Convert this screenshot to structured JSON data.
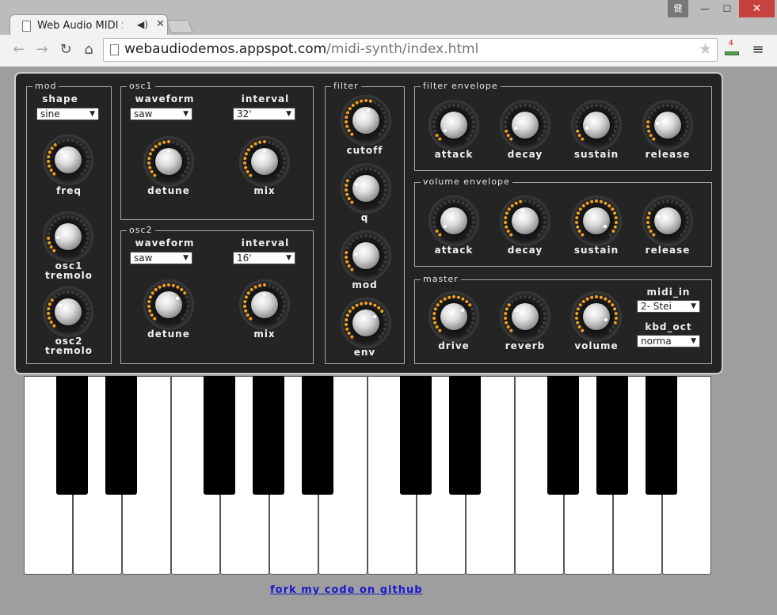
{
  "browser": {
    "tab_title": "Web Audio MIDI Syn",
    "user_badge": "健",
    "url_host": "webaudiodemos.appspot.com",
    "url_path": "/midi-synth/index.html",
    "extension_count": "4"
  },
  "synth": {
    "mod": {
      "title": "mod",
      "shape_label": "shape",
      "shape_value": "sine",
      "freq_label": "freq",
      "osc1_tremolo_line1": "osc1",
      "osc1_tremolo_line2": "tremolo",
      "osc2_tremolo_line1": "osc2",
      "osc2_tremolo_line2": "tremolo"
    },
    "osc1": {
      "title": "osc1",
      "waveform_label": "waveform",
      "waveform_value": "saw",
      "interval_label": "interval",
      "interval_value": "32'",
      "detune_label": "detune",
      "mix_label": "mix"
    },
    "osc2": {
      "title": "osc2",
      "waveform_label": "waveform",
      "waveform_value": "saw",
      "interval_label": "interval",
      "interval_value": "16'",
      "detune_label": "detune",
      "mix_label": "mix"
    },
    "filter": {
      "title": "filter",
      "cutoff_label": "cutoff",
      "q_label": "q",
      "mod_label": "mod",
      "env_label": "env"
    },
    "filter_envelope": {
      "title": "filter envelope",
      "attack_label": "attack",
      "decay_label": "decay",
      "sustain_label": "sustain",
      "release_label": "release"
    },
    "volume_envelope": {
      "title": "volume envelope",
      "attack_label": "attack",
      "decay_label": "decay",
      "sustain_label": "sustain",
      "release_label": "release"
    },
    "master": {
      "title": "master",
      "drive_label": "drive",
      "reverb_label": "reverb",
      "volume_label": "volume",
      "midi_in_label": "midi_in",
      "midi_in_value": "2- Stei",
      "kbd_oct_label": "kbd_oct",
      "kbd_oct_value": "norma"
    },
    "knob_levels": {
      "mod_freq": 0.35,
      "mod_osc1_tremolo": 0.15,
      "mod_osc2_tremolo": 0.3,
      "osc1_detune": 0.5,
      "osc1_mix": 0.5,
      "osc2_detune": 0.7,
      "osc2_mix": 0.5,
      "filter_cutoff": 0.55,
      "filter_q": 0.25,
      "filter_mod": 0.2,
      "filter_env": 0.7,
      "fenv_attack": 0.05,
      "fenv_decay": 0.1,
      "fenv_sustain": 0.1,
      "fenv_release": 0.2,
      "venv_attack": 0.05,
      "venv_decay": 0.45,
      "venv_sustain": 0.95,
      "venv_release": 0.25,
      "master_drive": 0.7,
      "master_reverb": 0.3,
      "master_volume": 0.9
    }
  },
  "footer": {
    "link_text": "fork my code on github"
  },
  "colors": {
    "led_on": "#f0a020",
    "led_off": "#3a3a3a",
    "panel_bg": "#242424",
    "link": "#1a1acc"
  }
}
